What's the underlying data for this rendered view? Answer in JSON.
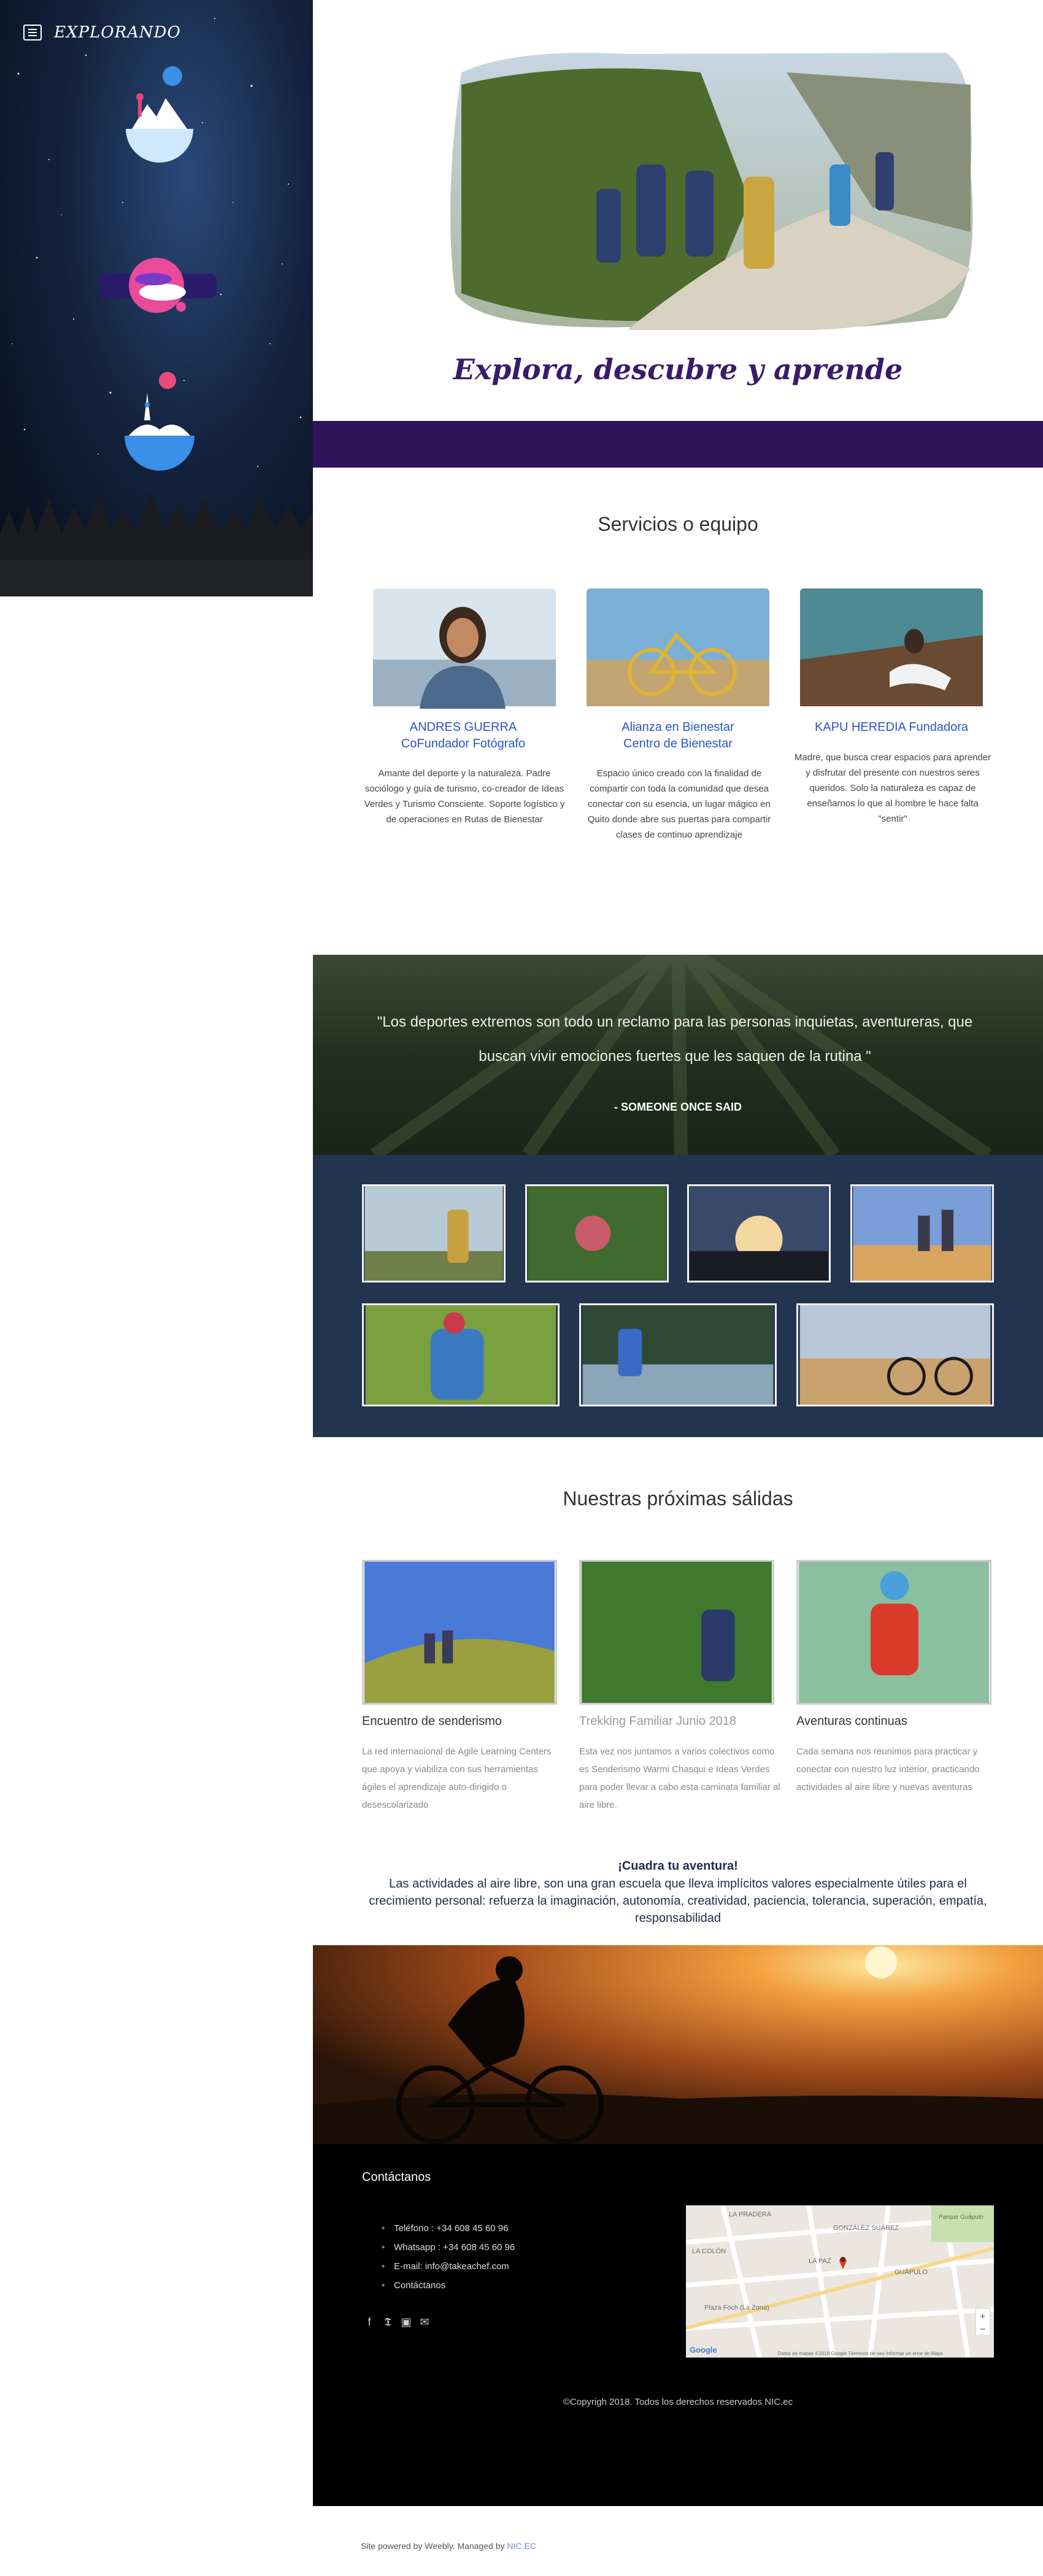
{
  "sidebar": {
    "brand": "EXPLORANDO"
  },
  "hero": {
    "title": "Explora, descubre y aprende"
  },
  "services": {
    "title": "Servicios o equipo",
    "items": [
      {
        "name_line1": "ANDRES GUERRA",
        "name_line2": "CoFundador   Fotógrafo",
        "description": "Amante del deporte y la naturaleza. Padre sociólogo y guía de turismo, co-creador de Ideas Verdes y Turismo Consciente. Soporte logístico y de operaciones en Rutas de Bienestar"
      },
      {
        "name_line1": "Alianza en Bienestar",
        "name_line2": "Centro de Bienestar",
        "description": "Espacio único creado con la finalidad de compartir con toda la comunidad que desea conectar con su esencia, un lugar mágico en Quito donde abre sus puertas para compartir clases de continuo aprendizaje"
      },
      {
        "name_line1": "KAPU HEREDIA Fundadora",
        "name_line2": "",
        "description": "Madre, que busca crear espacios para aprender y disfrutar del presente con nuestros seres queridos. Solo la naturaleza es capaz de enseñarnos lo que al hombre le hace falta \"sentir\""
      }
    ]
  },
  "quote": {
    "text": "\"Los deportes extremos son todo un reclamo para las personas inquietas, aventureras, que buscan vivir emociones fuertes que les saquen de la rutina \"",
    "author": "- SOMEONE ONCE SAID"
  },
  "trips": {
    "title": "Nuestras próximas sálidas",
    "items": [
      {
        "title": "Encuentro de senderismo",
        "description": "La red internacional de Agile Learning Centers que apoya y viabiliza con sus herramientas ágiles el aprendizaje auto-dirigido o desescolarizado"
      },
      {
        "title": "Trekking Familiar Junio 2018",
        "description": "Esta vez nos juntamos a varios colectivos como es Senderismo Warmi Chasqui e Ideas Verdes  para poder llevar a cabo esta caminata familiar al aire libre."
      },
      {
        "title": "Aventuras continuas",
        "description": "Cada semana    nos reunimos para practicar y conectar  con nuestro luz interior, practicando actividades al aire libre y nuevas aventuras"
      }
    ]
  },
  "cta": {
    "title": "¡Cuadra tu aventura!",
    "text": "Las actividades al aire libre, son una gran escuela que lleva implícitos valores especialmente útiles para el crecimiento personal: refuerza la imaginación, autonomía, creatividad, paciencia, tolerancia, superación, empatía, responsabilidad"
  },
  "footer": {
    "contact_title": "Contáctanos",
    "contacts": [
      "Teléfono : +34 608 45 60 96",
      "Whatsapp : +34 608 45 60 96",
      "E-mail: info@takeachef.com",
      "Contáctanos"
    ],
    "social_icons": [
      "facebook-icon",
      "twitter-icon",
      "instagram-icon",
      "mail-icon"
    ],
    "map": {
      "labels": [
        "LA PRADERA",
        "GONZÁLEZ SUÁREZ",
        "LA COLÓN",
        "LA PAZ",
        "GUÁPULO",
        "Plaza Foch (La Zona)",
        "Parque Guápulo"
      ],
      "zoom_in": "+",
      "zoom_out": "−",
      "google": "Google",
      "attribution": "Datos de mapas ©2018 Google   Términos de uso   Informar un error de Maps"
    },
    "copyright": "©Copyrigh 2018. Todos los derechos reservados NIC.ec"
  },
  "powered": {
    "text": "Site powered by Weebly. Managed by ",
    "link": "NIC.EC"
  }
}
